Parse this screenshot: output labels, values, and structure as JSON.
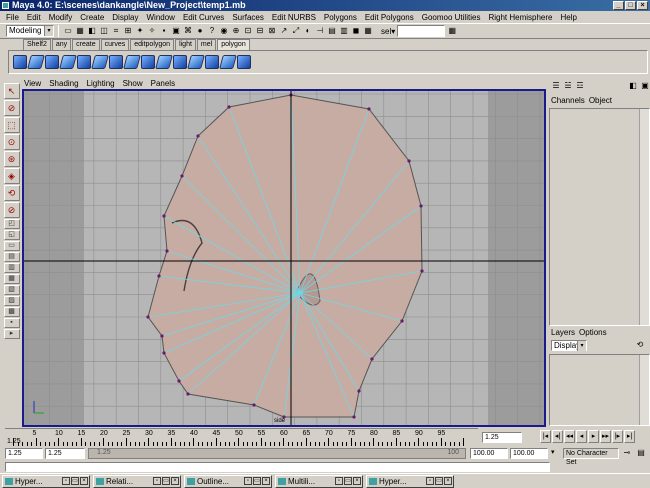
{
  "window": {
    "title": "Maya 4.0: E:\\scenes\\dankangle\\New_Project\\temp1.mb",
    "min": "_",
    "max": "□",
    "close": "×"
  },
  "menubar": [
    "File",
    "Edit",
    "Modify",
    "Create",
    "Display",
    "Window",
    "Edit Curves",
    "Surfaces",
    "Edit NURBS",
    "Polygons",
    "Edit Polygons",
    "Goomoo Utilities",
    "Right Hemisphere",
    "Help"
  ],
  "statusline": {
    "mode": "Modeling",
    "sel_label": "sel",
    "mode_arrow": "▾",
    "sel_arrow": "▾"
  },
  "shelf": {
    "tabs": [
      "Shelf2",
      "any",
      "create",
      "curves",
      "editpolygon",
      "light",
      "mel",
      "polygon"
    ],
    "active": "polygon"
  },
  "panel": {
    "menu": [
      "View",
      "Shading",
      "Lighting",
      "Show",
      "Panels"
    ],
    "camera_label": "side"
  },
  "right_panel": {
    "menu": [
      "Channels",
      "Object"
    ],
    "layers_menu": [
      "Layers",
      "Options"
    ],
    "display_combo": "Display",
    "combo_arrow": "▾"
  },
  "timeline": {
    "ticks": [
      "5",
      "10",
      "15",
      "20",
      "25",
      "30",
      "35",
      "40",
      "45",
      "50",
      "55",
      "60",
      "65",
      "70",
      "75",
      "80",
      "85",
      "90",
      "95"
    ],
    "start_marker": "1.25",
    "current_frame": "1.25"
  },
  "playback": [
    "|◂",
    "◂|",
    "◂◂",
    "◂",
    "▸",
    "▸▸",
    "|▸",
    "▸|"
  ],
  "range": {
    "start": "1.25",
    "start2": "1.25",
    "end": "100.00",
    "end2": "100.00",
    "char_set": "No Character Set",
    "slider_start": "1.25",
    "slider_end": "100",
    "combo_arrow": "▾"
  },
  "taskbar": [
    "Hyper...",
    "Relati...",
    "Outline...",
    "Multili...",
    "Hyper..."
  ],
  "task_btns": [
    "▫",
    "▭",
    "×"
  ],
  "icons": {
    "toolbar": [
      "▭",
      "▦",
      "◧",
      "◫",
      "⌗",
      "⊞",
      "✦",
      "✧",
      "▪",
      "▣",
      "⌘",
      "●",
      "?",
      "◉",
      "⊕",
      "⊡",
      "⊟",
      "⊠",
      "↗",
      "⤢",
      "◐",
      "⊣",
      "▤",
      "▥",
      "◼",
      "▦"
    ],
    "tools": [
      "↖",
      "⊘",
      "⬚",
      "⊙",
      "⊛",
      "◈",
      "⟲",
      "⊘",
      "◰",
      "◱",
      "▭",
      "▤",
      "▥",
      "▦",
      "▧",
      "▨",
      "▩",
      "▪",
      "▸"
    ]
  },
  "colors": {
    "viewport_bg": "#b6b6b6",
    "head_fill": "#c7aca3",
    "wire": "#6fd8e6",
    "vertex": "#6a1a6a",
    "axis": "#000000",
    "border": "#1a1a8a"
  }
}
